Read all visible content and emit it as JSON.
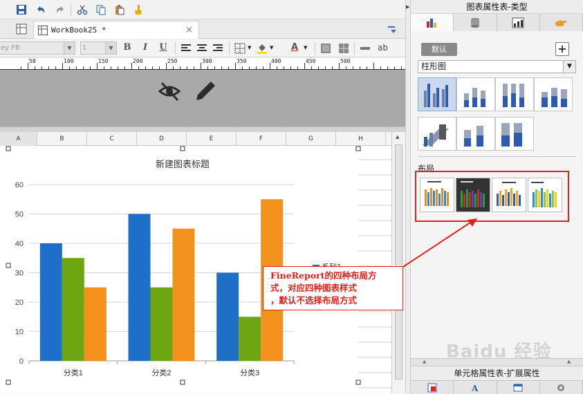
{
  "app": {
    "tab_label": "WorkBook25 *",
    "tab_close": "×"
  },
  "format_bar": {
    "font_value": "ey FB",
    "size_value": "1",
    "bold": "B",
    "italic": "I",
    "underline": "U",
    "text_color_label": "A",
    "ab_label": "ab"
  },
  "ruler": {
    "labels": [
      "50",
      "100",
      "150",
      "200",
      "250",
      "300",
      "350",
      "400",
      "450",
      "500"
    ]
  },
  "columns": [
    "A",
    "B",
    "C",
    "D",
    "E",
    "F",
    "G",
    "H"
  ],
  "chart_data": {
    "type": "bar",
    "title": "新建图表标题",
    "categories": [
      "分类1",
      "分类2",
      "分类3"
    ],
    "series": [
      {
        "name": "系列1",
        "values": [
          40,
          50,
          30
        ],
        "color": "#1f6fc8"
      },
      {
        "values": [
          35,
          25,
          15
        ],
        "color": "#6ea611"
      },
      {
        "values": [
          25,
          45,
          55
        ],
        "color": "#f2921c"
      }
    ],
    "ylim": [
      0,
      60
    ],
    "yticks": [
      "0",
      "10",
      "20",
      "30",
      "40",
      "50",
      "60"
    ],
    "grid": true,
    "legend_position": "right"
  },
  "callout": {
    "line1": "FineReport的四种布局方",
    "line2": "式，对应四种图表样式",
    "line3": "，默认不选择布局方式"
  },
  "panel": {
    "title": "图表属性表-类型",
    "default_button": "默认",
    "plus_button": "+",
    "chart_type_value": "柱形图",
    "layout_label": "布局",
    "bottom_title": "单元格属性表-扩展属性"
  },
  "watermark": "Baidu 经验"
}
